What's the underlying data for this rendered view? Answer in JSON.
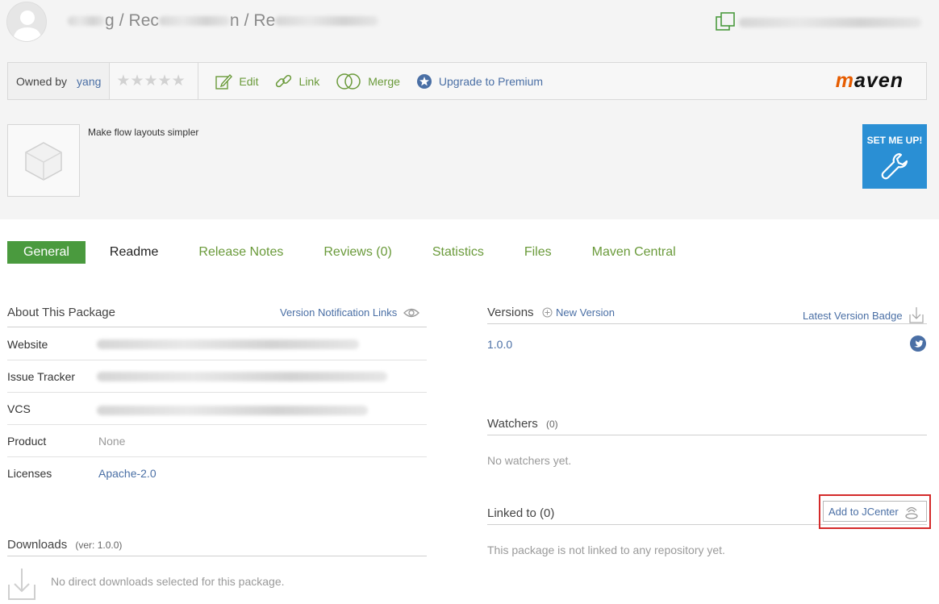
{
  "breadcrumb": {
    "sep1": "/",
    "seg2": "Rec",
    "sep2": "/",
    "seg3": "Re",
    "seg1_tail": "g"
  },
  "toolbar": {
    "owned_by": "Owned by",
    "owner": "yang",
    "rating_stars": 0,
    "edit": "Edit",
    "link": "Link",
    "merge": "Merge",
    "upgrade": "Upgrade to Premium",
    "maven_logo": "maven"
  },
  "package": {
    "description": "Make flow layouts simpler",
    "setup_label": "SET ME UP!"
  },
  "tabs": [
    {
      "label": "General"
    },
    {
      "label": "Readme"
    },
    {
      "label": "Release Notes"
    },
    {
      "label": "Reviews (0)"
    },
    {
      "label": "Statistics"
    },
    {
      "label": "Files"
    },
    {
      "label": "Maven Central"
    }
  ],
  "about": {
    "title": "About This Package",
    "notif_link": "Version Notification Links",
    "rows": [
      {
        "label": "Website",
        "value": ""
      },
      {
        "label": "Issue Tracker",
        "value": ""
      },
      {
        "label": "VCS",
        "value": ""
      },
      {
        "label": "Product",
        "value": "None"
      },
      {
        "label": "Licenses",
        "value": "Apache-2.0"
      }
    ]
  },
  "downloads": {
    "title": "Downloads",
    "version_note": "(ver: 1.0.0)",
    "empty": "No direct downloads selected for this package."
  },
  "versions": {
    "title": "Versions",
    "new_version": "New Version",
    "badge_link": "Latest Version Badge",
    "latest": "1.0.0"
  },
  "watchers": {
    "title": "Watchers",
    "count": "(0)",
    "empty": "No watchers yet."
  },
  "linked": {
    "title": "Linked to (0)",
    "add_jcenter": "Add to JCenter",
    "empty": "This package is not linked to any repository yet."
  },
  "colors": {
    "accent_green": "#4a9a3e",
    "link_blue": "#4a6fa5",
    "setup_blue": "#2a8fd4",
    "highlight_red": "#d42a2a"
  }
}
